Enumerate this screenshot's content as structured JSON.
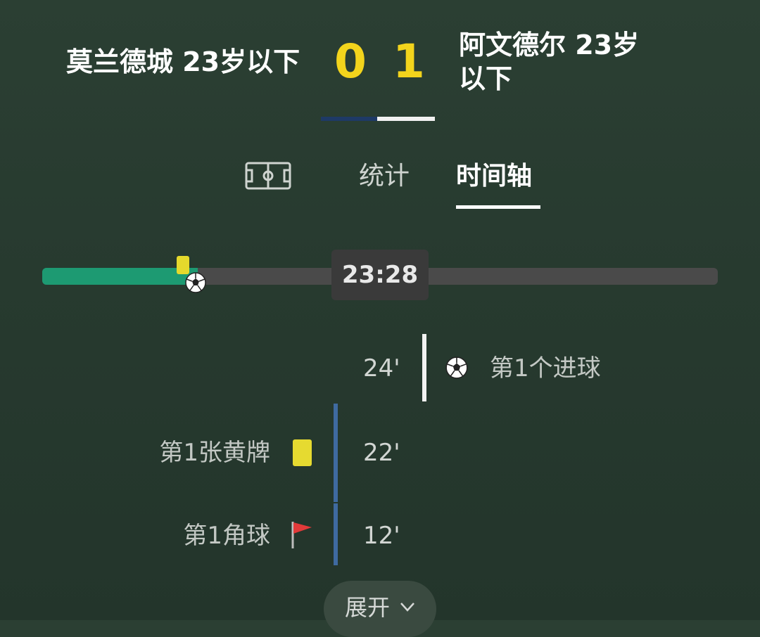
{
  "match": {
    "home_team": "莫兰德城 23岁以下",
    "away_team": "阿文德尔 23岁以下",
    "home_score": "0",
    "away_score": "1",
    "score_colors": {
      "score": "#f3d41c",
      "home_bar": "#1e3a66",
      "away_bar": "#f1f1f1"
    }
  },
  "tabs": [
    {
      "icon": "pitch-icon",
      "label": ""
    },
    {
      "label": "统计"
    },
    {
      "label": "时间轴",
      "selected": true
    }
  ],
  "progress": {
    "time": "23:28",
    "fill_fraction": 0.23,
    "fill_color": "#1d9a72",
    "markers": [
      "yellow-card-icon",
      "ball-icon"
    ]
  },
  "timeline": [
    {
      "minute": "24'",
      "side": "away",
      "icon": "ball-icon",
      "text": "第1个进球"
    },
    {
      "minute": "22'",
      "side": "home",
      "icon": "yellow-card-icon",
      "text": "第1张黄牌"
    },
    {
      "minute": "12'",
      "side": "home",
      "icon": "corner-flag-icon",
      "text": "第1角球"
    }
  ],
  "expand_button": {
    "label": "展开",
    "icon": "chevron-down-icon"
  }
}
